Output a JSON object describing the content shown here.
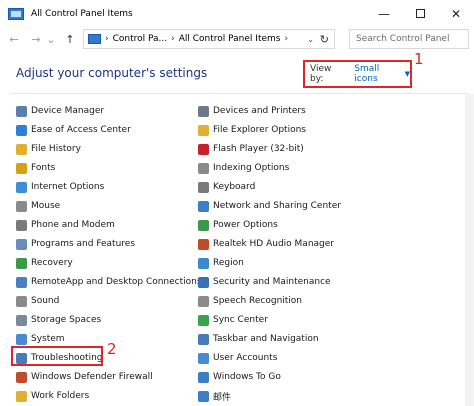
{
  "window": {
    "title": "All Control Panel Items",
    "min_glyph": "—",
    "close_glyph": "✕"
  },
  "nav": {
    "back_glyph": "←",
    "forward_glyph": "→",
    "recent_glyph": "⌄",
    "up_glyph": "↑",
    "breadcrumb": [
      "Control Pa...",
      "All Control Panel Items"
    ],
    "sep_glyph": "›",
    "dropdown_glyph": "⌄",
    "refresh_glyph": "↻",
    "search_placeholder": "Search Control Panel"
  },
  "header": {
    "title": "Adjust your computer's settings",
    "view_by_label": "View by:",
    "view_by_value": "Small icons",
    "caret_glyph": "▼"
  },
  "annotations": {
    "view_by": "1",
    "troubleshooting": "2"
  },
  "colors": {
    "accent_red": "#e0262a",
    "heading_blue": "#1e3287",
    "link_blue": "#0066cc"
  },
  "items_left": [
    {
      "label": "Device Manager",
      "icon": "device-manager-icon",
      "color": "#5a7fb0"
    },
    {
      "label": "Ease of Access Center",
      "icon": "ease-of-access-icon",
      "color": "#2f7fd8"
    },
    {
      "label": "File History",
      "icon": "file-history-icon",
      "color": "#e0b030"
    },
    {
      "label": "Fonts",
      "icon": "fonts-icon",
      "color": "#d4a017"
    },
    {
      "label": "Internet Options",
      "icon": "internet-options-icon",
      "color": "#3c8fd6"
    },
    {
      "label": "Mouse",
      "icon": "mouse-icon",
      "color": "#8a8a8a"
    },
    {
      "label": "Phone and Modem",
      "icon": "phone-modem-icon",
      "color": "#7a7a7a"
    },
    {
      "label": "Programs and Features",
      "icon": "programs-features-icon",
      "color": "#6a8cb8"
    },
    {
      "label": "Recovery",
      "icon": "recovery-icon",
      "color": "#3a9a4a"
    },
    {
      "label": "RemoteApp and Desktop Connections",
      "icon": "remoteapp-icon",
      "color": "#4a7fc0"
    },
    {
      "label": "Sound",
      "icon": "sound-icon",
      "color": "#8a8a8a"
    },
    {
      "label": "Storage Spaces",
      "icon": "storage-spaces-icon",
      "color": "#7a8a9a"
    },
    {
      "label": "System",
      "icon": "system-icon",
      "color": "#4a8ad0"
    },
    {
      "label": "Troubleshooting",
      "icon": "troubleshooting-icon",
      "color": "#4a7ab8"
    },
    {
      "label": "Windows Defender Firewall",
      "icon": "firewall-icon",
      "color": "#c04a2a"
    },
    {
      "label": "Work Folders",
      "icon": "work-folders-icon",
      "color": "#e0b030"
    }
  ],
  "items_right": [
    {
      "label": "Devices and Printers",
      "icon": "devices-printers-icon",
      "color": "#6a7a8a"
    },
    {
      "label": "File Explorer Options",
      "icon": "file-explorer-options-icon",
      "color": "#e0b030"
    },
    {
      "label": "Flash Player (32-bit)",
      "icon": "flash-player-icon",
      "color": "#c8202a"
    },
    {
      "label": "Indexing Options",
      "icon": "indexing-options-icon",
      "color": "#8a8a8a"
    },
    {
      "label": "Keyboard",
      "icon": "keyboard-icon",
      "color": "#7a7a7a"
    },
    {
      "label": "Network and Sharing Center",
      "icon": "network-sharing-icon",
      "color": "#3a7fc8"
    },
    {
      "label": "Power Options",
      "icon": "power-options-icon",
      "color": "#3a9a4a"
    },
    {
      "label": "Realtek HD Audio Manager",
      "icon": "realtek-audio-icon",
      "color": "#c04a2a"
    },
    {
      "label": "Region",
      "icon": "region-icon",
      "color": "#3a8ad0"
    },
    {
      "label": "Security and Maintenance",
      "icon": "security-maintenance-icon",
      "color": "#3a6fb8"
    },
    {
      "label": "Speech Recognition",
      "icon": "speech-recognition-icon",
      "color": "#8a8a8a"
    },
    {
      "label": "Sync Center",
      "icon": "sync-center-icon",
      "color": "#3aa04a"
    },
    {
      "label": "Taskbar and Navigation",
      "icon": "taskbar-navigation-icon",
      "color": "#4a7ab8"
    },
    {
      "label": "User Accounts",
      "icon": "user-accounts-icon",
      "color": "#4a8ad0"
    },
    {
      "label": "Windows To Go",
      "icon": "windows-to-go-icon",
      "color": "#3a7fc8"
    },
    {
      "label": "邮件",
      "icon": "mail-icon",
      "color": "#3a7fc8"
    }
  ]
}
